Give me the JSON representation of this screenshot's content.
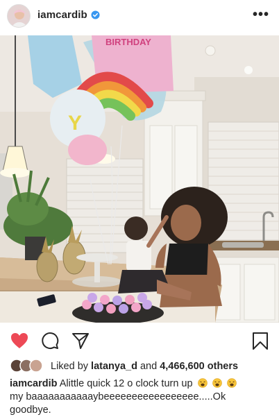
{
  "post": {
    "username": "iamcardib",
    "verified": true,
    "more_icon": "more-options-icon"
  },
  "photo": {
    "balloon_text": "BIRTHDAY"
  },
  "actions": {
    "icons": [
      "heart-icon-filled",
      "comment-icon",
      "share-icon",
      "bookmark-icon"
    ],
    "heart_color": "#ed4956"
  },
  "likes": {
    "prefix": "Liked by",
    "liked_by_user": "latanya_d",
    "connector": "and",
    "others": "4,466,600 others"
  },
  "caption": {
    "username": "iamcardib",
    "text_line1": "Alittle quick 12 o clock turn up",
    "emojis": [
      "weary-face-emoji",
      "weary-face-emoji",
      "weary-face-emoji"
    ],
    "text_line2": "my baaaaaaaaaaaybeeeeeeeeeeeeeeeee.....Ok",
    "text_line3": "goodbye."
  }
}
